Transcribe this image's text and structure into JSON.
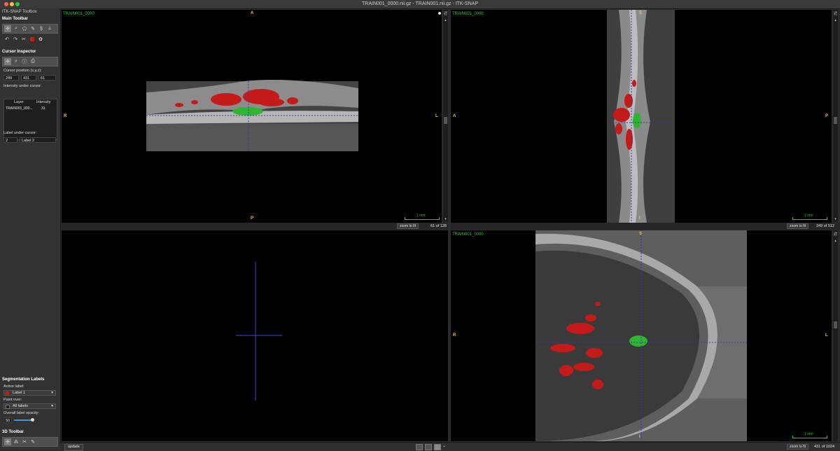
{
  "window": {
    "title": "TRAIN001_0000.nii.gz - TRAIN001.nii.gz - ITK-SNAP"
  },
  "toolbox": {
    "title": "ITK-SNAP Toolbox",
    "main_toolbar": {
      "label": "Main Toolbar",
      "tools_row1": [
        "crosshair-icon",
        "zoom-icon",
        "polygon-icon",
        "paintbrush-icon",
        "snake-icon",
        "ruler-icon"
      ],
      "tools_row2": [
        "undo-icon",
        "redo-icon",
        "scissors-icon",
        "layer-inspector-icon",
        "label-wheel-icon"
      ]
    },
    "cursor_inspector": {
      "label": "Cursor Inspector",
      "position_label": "Cursor position (x,y,z):",
      "x": "249",
      "y": "431",
      "z": "61",
      "intensity_label": "Intensity under cursor:",
      "table_headers": [
        "Layer",
        "Intensity"
      ],
      "rows": [
        {
          "layer": "TRAIN001_000...",
          "intensity": "31"
        }
      ],
      "label_under_cursor": "Label under cursor:",
      "label_id": "2",
      "label_name": "Label 2"
    },
    "segmentation_labels": {
      "label": "Segmentation Labels",
      "active_label_caption": "Active label:",
      "active_label": "Label 1",
      "active_color": "#c41a1a",
      "paint_over_caption": "Paint over:",
      "paint_over": "All labels",
      "opacity_caption": "Overall label opacity:",
      "opacity_value": "50"
    },
    "toolbar_3d": {
      "label": "3D Toolbar"
    }
  },
  "views": {
    "axial": {
      "layer": "TRAIN001_0000",
      "top": "A",
      "bottom": "P",
      "left": "R",
      "right": "L",
      "scale": "1 mm",
      "zoom_button": "zoom to fit",
      "slice": "61 of 128"
    },
    "sagittal": {
      "layer": "TRAIN001_0000",
      "top": "S",
      "bottom": "I",
      "left": "A",
      "right": "P",
      "scale": "1 mm",
      "zoom_button": "zoom to fit",
      "slice": "249 of 512"
    },
    "coronal": {
      "layer": "TRAIN001_0000",
      "top": "S",
      "bottom": "I",
      "left": "R",
      "right": "L",
      "scale": "1 mm",
      "zoom_button": "zoom to fit",
      "slice": "431 of 1024"
    }
  },
  "bottom": {
    "update_button": "update"
  },
  "colors": {
    "label_red": "#c41a1a",
    "label_green": "#2fb52f",
    "crosshair": "#3a3aa8",
    "annotation": "#3fbf3f",
    "orientation": "#e8c35a"
  }
}
